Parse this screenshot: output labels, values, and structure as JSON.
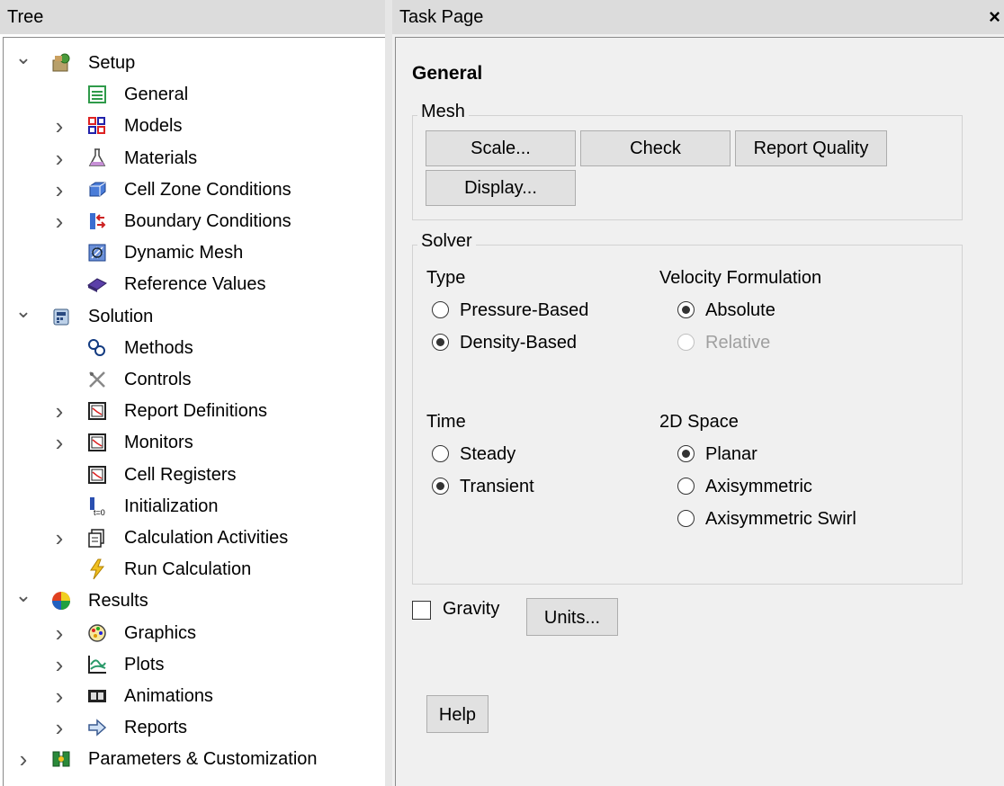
{
  "tree": {
    "header": "Tree",
    "items": [
      {
        "label": "Setup",
        "chevron": "expanded",
        "icon": "setup-icon"
      },
      {
        "label": "General",
        "chevron": "none",
        "icon": "general-icon"
      },
      {
        "label": "Models",
        "chevron": "collapsed",
        "icon": "models-icon"
      },
      {
        "label": "Materials",
        "chevron": "collapsed",
        "icon": "materials-icon"
      },
      {
        "label": "Cell Zone Conditions",
        "chevron": "collapsed",
        "icon": "cell-zone-icon"
      },
      {
        "label": "Boundary Conditions",
        "chevron": "collapsed",
        "icon": "boundary-icon"
      },
      {
        "label": "Dynamic Mesh",
        "chevron": "none",
        "icon": "dynamic-mesh-icon"
      },
      {
        "label": "Reference Values",
        "chevron": "none",
        "icon": "reference-values-icon"
      },
      {
        "label": "Solution",
        "chevron": "expanded",
        "icon": "solution-icon"
      },
      {
        "label": "Methods",
        "chevron": "none",
        "icon": "methods-icon"
      },
      {
        "label": "Controls",
        "chevron": "none",
        "icon": "controls-icon"
      },
      {
        "label": "Report Definitions",
        "chevron": "collapsed",
        "icon": "report-definitions-icon"
      },
      {
        "label": "Monitors",
        "chevron": "collapsed",
        "icon": "monitors-icon"
      },
      {
        "label": "Cell Registers",
        "chevron": "none",
        "icon": "cell-registers-icon"
      },
      {
        "label": "Initialization",
        "chevron": "none",
        "icon": "initialization-icon"
      },
      {
        "label": "Calculation Activities",
        "chevron": "collapsed",
        "icon": "calculation-activities-icon"
      },
      {
        "label": "Run Calculation",
        "chevron": "none",
        "icon": "run-calculation-icon"
      },
      {
        "label": "Results",
        "chevron": "expanded",
        "icon": "results-icon"
      },
      {
        "label": "Graphics",
        "chevron": "collapsed",
        "icon": "graphics-icon"
      },
      {
        "label": "Plots",
        "chevron": "collapsed",
        "icon": "plots-icon"
      },
      {
        "label": "Animations",
        "chevron": "collapsed",
        "icon": "animations-icon"
      },
      {
        "label": "Reports",
        "chevron": "collapsed",
        "icon": "reports-icon"
      },
      {
        "label": "Parameters & Customization",
        "chevron": "collapsed",
        "icon": "parameters-icon"
      }
    ]
  },
  "task": {
    "header": "Task Page",
    "close": "×",
    "title": "General",
    "mesh": {
      "label": "Mesh",
      "scale": "Scale...",
      "check": "Check",
      "report_quality": "Report Quality",
      "display": "Display..."
    },
    "solver": {
      "label": "Solver",
      "type_label": "Type",
      "pressure_based": "Pressure-Based",
      "density_based": "Density-Based",
      "velocity_label": "Velocity Formulation",
      "absolute": "Absolute",
      "relative": "Relative",
      "time_label": "Time",
      "steady": "Steady",
      "transient": "Transient",
      "space_label": "2D Space",
      "planar": "Planar",
      "axisymmetric": "Axisymmetric",
      "axisymmetric_swirl": "Axisymmetric Swirl"
    },
    "gravity": "Gravity",
    "units": "Units...",
    "help": "Help"
  }
}
